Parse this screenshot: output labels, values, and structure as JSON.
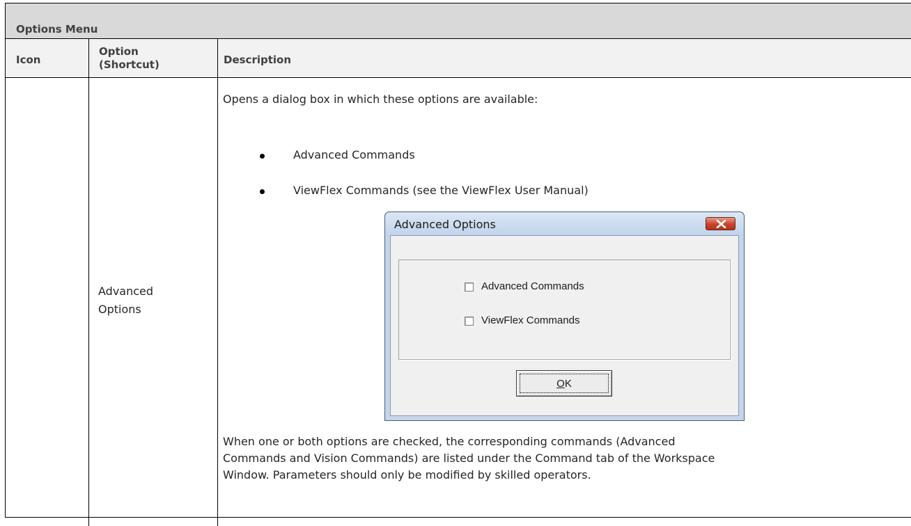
{
  "table": {
    "title": "Options Menu",
    "headers": {
      "icon": "Icon",
      "option_line1": "Option",
      "option_line2": "(Shortcut)",
      "description": "Description"
    },
    "row": {
      "option_line1": "Advanced",
      "option_line2": "Options",
      "intro": "Opens a dialog box in which these options are available:",
      "bullets": [
        "Advanced Commands",
        "ViewFlex Commands (see the ViewFlex User Manual)"
      ],
      "footer_lines": [
        "When one or both options are checked, the corresponding commands (Advanced",
        "Commands and Vision Commands) are listed under the Command tab of the Workspace",
        "Window. Parameters should only be modified by skilled operators."
      ]
    }
  },
  "dialog": {
    "title": "Advanced Options",
    "checkboxes": [
      {
        "label": "Advanced Commands",
        "checked": false
      },
      {
        "label": "ViewFlex Commands",
        "checked": false
      }
    ],
    "ok_mnemonic": "O",
    "ok_rest": "K"
  },
  "colors": {
    "title_bg": "#d9d9d9",
    "header_bg": "#f2f2f2",
    "close_red": "#c9442a",
    "dialog_frame": "#c5d6ea"
  }
}
